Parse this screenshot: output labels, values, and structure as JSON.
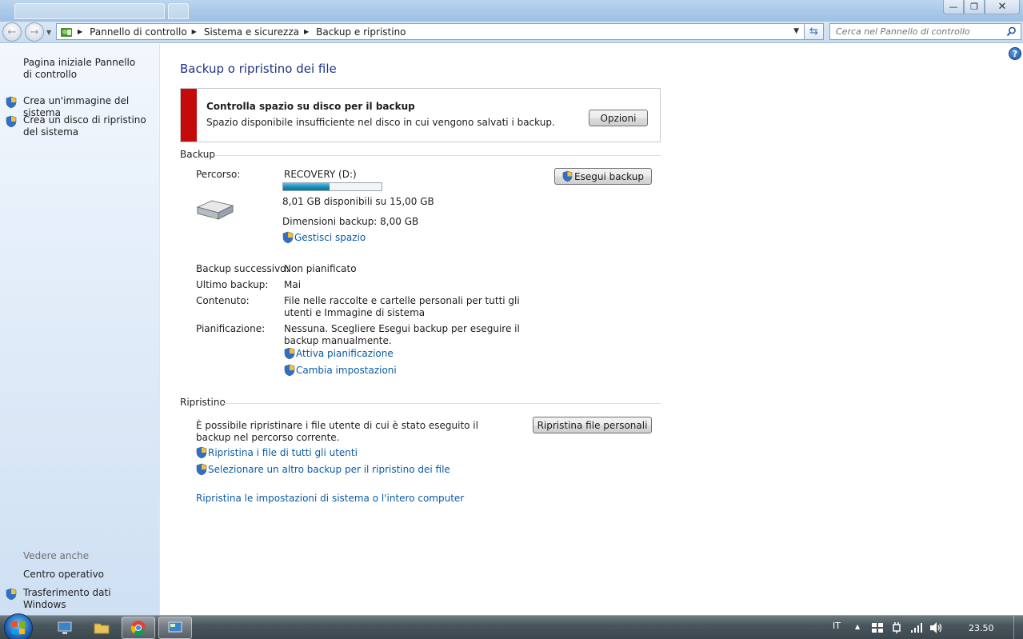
{
  "titlebar": {
    "caption_buttons": [
      "minimize",
      "restore",
      "close"
    ]
  },
  "address": {
    "breadcrumbs": [
      "Pannello di controllo",
      "Sistema e sicurezza",
      "Backup e ripristino"
    ],
    "search_placeholder": "Cerca nel Pannello di controllo"
  },
  "sidebar": {
    "items": [
      {
        "label": "Pagina iniziale Pannello di controllo",
        "icon": null
      },
      {
        "label": "Crea un'immagine del sistema",
        "icon": "shield-icon"
      },
      {
        "label": "Crea un disco di ripristino del sistema",
        "icon": "shield-icon"
      }
    ],
    "see_also_heading": "Vedere anche",
    "see_also": [
      {
        "label": "Centro operativo",
        "icon": null
      },
      {
        "label": "Trasferimento dati Windows",
        "icon": "shield-icon"
      }
    ]
  },
  "main": {
    "title": "Backup o ripristino dei file",
    "warning": {
      "title": "Controlla spazio su disco per il backup",
      "text": "Spazio disponibile insufficiente nel disco in cui vengono salvati i backup.",
      "button": "Opzioni",
      "color": "#c40a0a"
    },
    "backup": {
      "heading": "Backup",
      "path_label": "Percorso:",
      "drive_name": "RECOVERY (D:)",
      "usage_fraction": 0.47,
      "space_text": "8,01 GB disponibili su 15,00 GB",
      "size_text": "Dimensioni backup: 8,00 GB",
      "manage_link": "Gestisci spazio",
      "run_button": "Esegui backup",
      "next_label": "Backup successivo:",
      "next_value": "Non pianificato",
      "last_label": "Ultimo backup:",
      "last_value": "Mai",
      "content_label": "Contenuto:",
      "content_value": "File nelle raccolte e cartelle personali per tutti gli utenti e Immagine di sistema",
      "schedule_label": "Pianificazione:",
      "schedule_value": "Nessuna. Scegliere Esegui backup per eseguire il backup manualmente.",
      "enable_schedule_link": "Attiva pianificazione",
      "change_settings_link": "Cambia impostazioni"
    },
    "restore": {
      "heading": "Ripristino",
      "text": "È possibile ripristinare i file utente di cui è stato eseguito il backup nel percorso corrente.",
      "button": "Ripristina file personali",
      "all_users_link": "Ripristina i file di tutti gli utenti",
      "other_backup_link": "Selezionare un altro backup per il ripristino dei file",
      "system_link": "Ripristina le impostazioni di sistema o l'intero computer"
    }
  },
  "taskbar": {
    "language": "IT",
    "clock": "23.50"
  }
}
